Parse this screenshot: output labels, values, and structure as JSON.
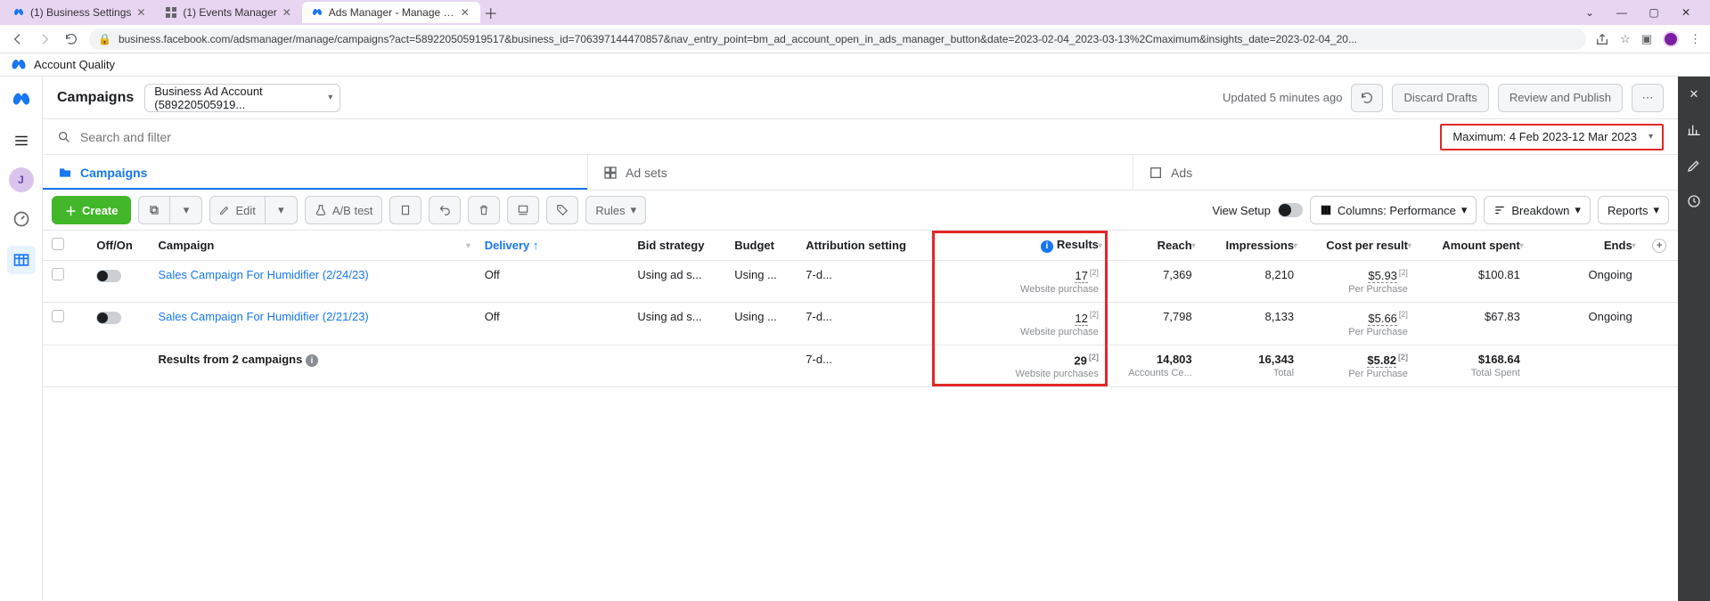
{
  "browser": {
    "tabs": [
      {
        "label": "(1) Business Settings",
        "favicon": "meta"
      },
      {
        "label": "(1) Events Manager",
        "favicon": "grid"
      },
      {
        "label": "Ads Manager - Manage ads - Ca",
        "favicon": "meta",
        "active": true
      }
    ],
    "url": "business.facebook.com/adsmanager/manage/campaigns?act=589220505919517&business_id=706397144470857&nav_entry_point=bm_ad_account_open_in_ads_manager_button&date=2023-02-04_2023-03-13%2Cmaximum&insights_date=2023-02-04_20..."
  },
  "subbar": {
    "label": "Account Quality"
  },
  "leftrail": {
    "avatar_initial": "J"
  },
  "topbar": {
    "title": "Campaigns",
    "account": "Business Ad Account (589220505919...",
    "updated": "Updated 5 minutes ago",
    "discard": "Discard Drafts",
    "review": "Review and Publish"
  },
  "search": {
    "placeholder": "Search and filter"
  },
  "daterange": {
    "label": "Maximum: 4 Feb 2023-12 Mar 2023"
  },
  "leveltabs": {
    "campaigns": "Campaigns",
    "adsets": "Ad sets",
    "ads": "Ads"
  },
  "toolbar": {
    "create": "Create",
    "edit": "Edit",
    "abtest": "A/B test",
    "rules": "Rules",
    "viewsetup": "View Setup",
    "columns": "Columns: Performance",
    "breakdown": "Breakdown",
    "reports": "Reports"
  },
  "columns": {
    "onoff": "Off/On",
    "campaign": "Campaign",
    "delivery": "Delivery",
    "bid": "Bid strategy",
    "budget": "Budget",
    "attr": "Attribution setting",
    "results": "Results",
    "reach": "Reach",
    "impressions": "Impressions",
    "cpr": "Cost per result",
    "spent": "Amount spent",
    "ends": "Ends"
  },
  "rows": [
    {
      "name": "Sales Campaign For Humidifier (2/24/23)",
      "delivery": "Off",
      "bid": "Using ad s...",
      "budget": "Using ...",
      "attr": "7-d...",
      "results": "17",
      "results_sub": "Website purchase",
      "reach": "7,369",
      "impressions": "8,210",
      "cpr": "$5.93",
      "cpr_sub": "Per Purchase",
      "spent": "$100.81",
      "ends": "Ongoing"
    },
    {
      "name": "Sales Campaign For Humidifier (2/21/23)",
      "delivery": "Off",
      "bid": "Using ad s...",
      "budget": "Using ...",
      "attr": "7-d...",
      "results": "12",
      "results_sub": "Website purchase",
      "reach": "7,798",
      "impressions": "8,133",
      "cpr": "$5.66",
      "cpr_sub": "Per Purchase",
      "spent": "$67.83",
      "ends": "Ongoing"
    }
  ],
  "totals": {
    "label": "Results from 2 campaigns",
    "attr": "7-d...",
    "results": "29",
    "results_sub": "Website purchases",
    "reach": "14,803",
    "reach_sub": "Accounts Ce...",
    "impressions": "16,343",
    "impressions_sub": "Total",
    "cpr": "$5.82",
    "cpr_sub": "Per Purchase",
    "spent": "$168.64",
    "spent_sub": "Total Spent"
  },
  "footnote": "[2]"
}
